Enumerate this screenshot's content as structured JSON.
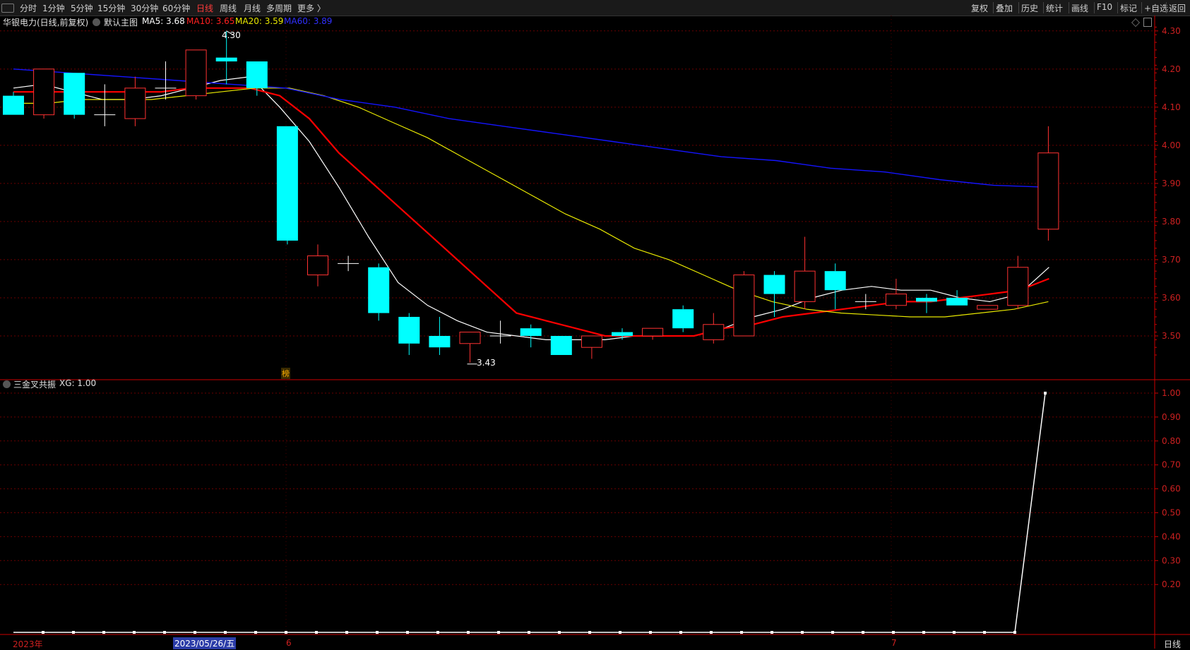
{
  "toolbar": {
    "left": [
      "分时",
      "1分钟",
      "5分钟",
      "15分钟",
      "30分钟",
      "60分钟",
      "日线",
      "周线",
      "月线",
      "多周期",
      "更多 〉"
    ],
    "active": "日线",
    "right": [
      "复权",
      "叠加",
      "历史",
      "统计",
      "画线",
      "F10",
      "标记",
      "+自选",
      "返回"
    ]
  },
  "main_header": {
    "stock": "华银电力(日线,前复权)",
    "template": "默认主图",
    "ma5": "MA5: 3.68",
    "ma10": "MA10: 3.65",
    "ma20": "MA20: 3.59",
    "ma60": "MA60: 3.89"
  },
  "sub_header": {
    "indicator": "三金叉共振",
    "xg": "XG: 1.00"
  },
  "annotations": {
    "high": "4.30",
    "low": "3.43",
    "bang": "榜"
  },
  "bottom": {
    "year": "2023年",
    "cursor_date": "2023/05/26/五",
    "month6": "6",
    "month7": "7",
    "period": "日线"
  },
  "colors": {
    "up": "#ff3232",
    "down": "#00ffff",
    "ma5": "#ffffff",
    "ma10": "#ff0000",
    "ma20": "#e8e800",
    "ma60": "#1414ff",
    "axis": "#cc0000",
    "grid": "#6a0000"
  },
  "chart_data": [
    {
      "type": "candlestick",
      "title": "华银电力(日线,前复权)",
      "ylim": [
        3.4,
        4.32
      ],
      "y_ticks": [
        4.3,
        4.2,
        4.1,
        4.0,
        3.9,
        3.8,
        3.7,
        3.6,
        3.5
      ],
      "candles": [
        {
          "o": 4.13,
          "h": 4.14,
          "l": 4.08,
          "c": 4.08
        },
        {
          "o": 4.08,
          "h": 4.2,
          "l": 4.07,
          "c": 4.2
        },
        {
          "o": 4.19,
          "h": 4.19,
          "l": 4.07,
          "c": 4.08
        },
        {
          "o": 4.08,
          "h": 4.16,
          "l": 4.05,
          "c": 4.08
        },
        {
          "o": 4.07,
          "h": 4.18,
          "l": 4.05,
          "c": 4.15
        },
        {
          "o": 4.15,
          "h": 4.22,
          "l": 4.12,
          "c": 4.15
        },
        {
          "o": 4.13,
          "h": 4.25,
          "l": 4.12,
          "c": 4.25
        },
        {
          "o": 4.23,
          "h": 4.3,
          "l": 4.16,
          "c": 4.22
        },
        {
          "o": 4.22,
          "h": 4.22,
          "l": 4.13,
          "c": 4.15
        },
        {
          "o": 4.05,
          "h": 4.05,
          "l": 3.74,
          "c": 3.75
        },
        {
          "o": 3.66,
          "h": 3.74,
          "l": 3.63,
          "c": 3.71
        },
        {
          "o": 3.69,
          "h": 3.71,
          "l": 3.67,
          "c": 3.69
        },
        {
          "o": 3.68,
          "h": 3.69,
          "l": 3.54,
          "c": 3.56
        },
        {
          "o": 3.55,
          "h": 3.56,
          "l": 3.45,
          "c": 3.48
        },
        {
          "o": 3.5,
          "h": 3.55,
          "l": 3.45,
          "c": 3.47
        },
        {
          "o": 3.48,
          "h": 3.51,
          "l": 3.43,
          "c": 3.51
        },
        {
          "o": 3.5,
          "h": 3.54,
          "l": 3.48,
          "c": 3.5
        },
        {
          "o": 3.52,
          "h": 3.53,
          "l": 3.47,
          "c": 3.5
        },
        {
          "o": 3.5,
          "h": 3.5,
          "l": 3.45,
          "c": 3.45
        },
        {
          "o": 3.47,
          "h": 3.5,
          "l": 3.44,
          "c": 3.5
        },
        {
          "o": 3.51,
          "h": 3.52,
          "l": 3.49,
          "c": 3.5
        },
        {
          "o": 3.5,
          "h": 3.52,
          "l": 3.49,
          "c": 3.52
        },
        {
          "o": 3.57,
          "h": 3.58,
          "l": 3.51,
          "c": 3.52
        },
        {
          "o": 3.49,
          "h": 3.56,
          "l": 3.48,
          "c": 3.53
        },
        {
          "o": 3.5,
          "h": 3.67,
          "l": 3.5,
          "c": 3.66
        },
        {
          "o": 3.66,
          "h": 3.67,
          "l": 3.55,
          "c": 3.61
        },
        {
          "o": 3.59,
          "h": 3.76,
          "l": 3.57,
          "c": 3.67
        },
        {
          "o": 3.67,
          "h": 3.69,
          "l": 3.57,
          "c": 3.62
        },
        {
          "o": 3.59,
          "h": 3.61,
          "l": 3.57,
          "c": 3.59
        },
        {
          "o": 3.58,
          "h": 3.65,
          "l": 3.57,
          "c": 3.61
        },
        {
          "o": 3.6,
          "h": 3.61,
          "l": 3.56,
          "c": 3.59
        },
        {
          "o": 3.6,
          "h": 3.62,
          "l": 3.58,
          "c": 3.58
        },
        {
          "o": 3.57,
          "h": 3.58,
          "l": 3.57,
          "c": 3.58
        },
        {
          "o": 3.58,
          "h": 3.71,
          "l": 3.57,
          "c": 3.68
        },
        {
          "o": 3.78,
          "h": 4.05,
          "l": 3.75,
          "c": 3.98
        }
      ],
      "series": [
        {
          "name": "MA5",
          "values": [
            4.15,
            4.16,
            4.14,
            4.12,
            4.12,
            4.13,
            4.15,
            4.17,
            4.18,
            4.1,
            4.01,
            3.89,
            3.76,
            3.64,
            3.58,
            3.54,
            3.51,
            3.5,
            3.49,
            3.49,
            3.49,
            3.5,
            3.5,
            3.5,
            3.52,
            3.55,
            3.57,
            3.6,
            3.62,
            3.63,
            3.62,
            3.62,
            3.6,
            3.59,
            3.61,
            3.68
          ]
        },
        {
          "name": "MA10",
          "values": [
            4.14,
            4.14,
            4.14,
            4.14,
            4.14,
            4.14,
            4.15,
            4.15,
            4.15,
            4.13,
            4.07,
            3.98,
            3.91,
            3.84,
            3.77,
            3.7,
            3.63,
            3.56,
            3.54,
            3.52,
            3.5,
            3.5,
            3.5,
            3.5,
            3.52,
            3.53,
            3.55,
            3.56,
            3.57,
            3.58,
            3.59,
            3.59,
            3.6,
            3.61,
            3.62,
            3.65
          ]
        },
        {
          "name": "MA20",
          "values": [
            4.11,
            4.11,
            4.12,
            4.12,
            4.12,
            4.13,
            4.14,
            4.15,
            4.15,
            4.13,
            4.1,
            4.06,
            4.02,
            3.97,
            3.92,
            3.87,
            3.82,
            3.78,
            3.73,
            3.7,
            3.66,
            3.62,
            3.59,
            3.57,
            3.56,
            3.555,
            3.55,
            3.55,
            3.56,
            3.57,
            3.59
          ]
        },
        {
          "name": "MA60",
          "values": [
            4.2,
            4.19,
            4.18,
            4.17,
            4.16,
            4.15,
            4.12,
            4.1,
            4.07,
            4.05,
            4.03,
            4.01,
            3.99,
            3.97,
            3.96,
            3.94,
            3.93,
            3.91,
            3.895,
            3.89
          ]
        }
      ]
    },
    {
      "type": "line",
      "title": "三金叉共振",
      "ylim": [
        0,
        1.05
      ],
      "y_ticks": [
        1.0,
        0.9,
        0.8,
        0.7,
        0.6,
        0.5,
        0.4,
        0.3,
        0.2
      ],
      "series": [
        {
          "name": "XG",
          "values": [
            0,
            0,
            0,
            0,
            0,
            0,
            0,
            0,
            0,
            0,
            0,
            0,
            0,
            0,
            0,
            0,
            0,
            0,
            0,
            0,
            0,
            0,
            0,
            0,
            0,
            0,
            0,
            0,
            0,
            0,
            0,
            0,
            0,
            1
          ]
        }
      ]
    }
  ]
}
